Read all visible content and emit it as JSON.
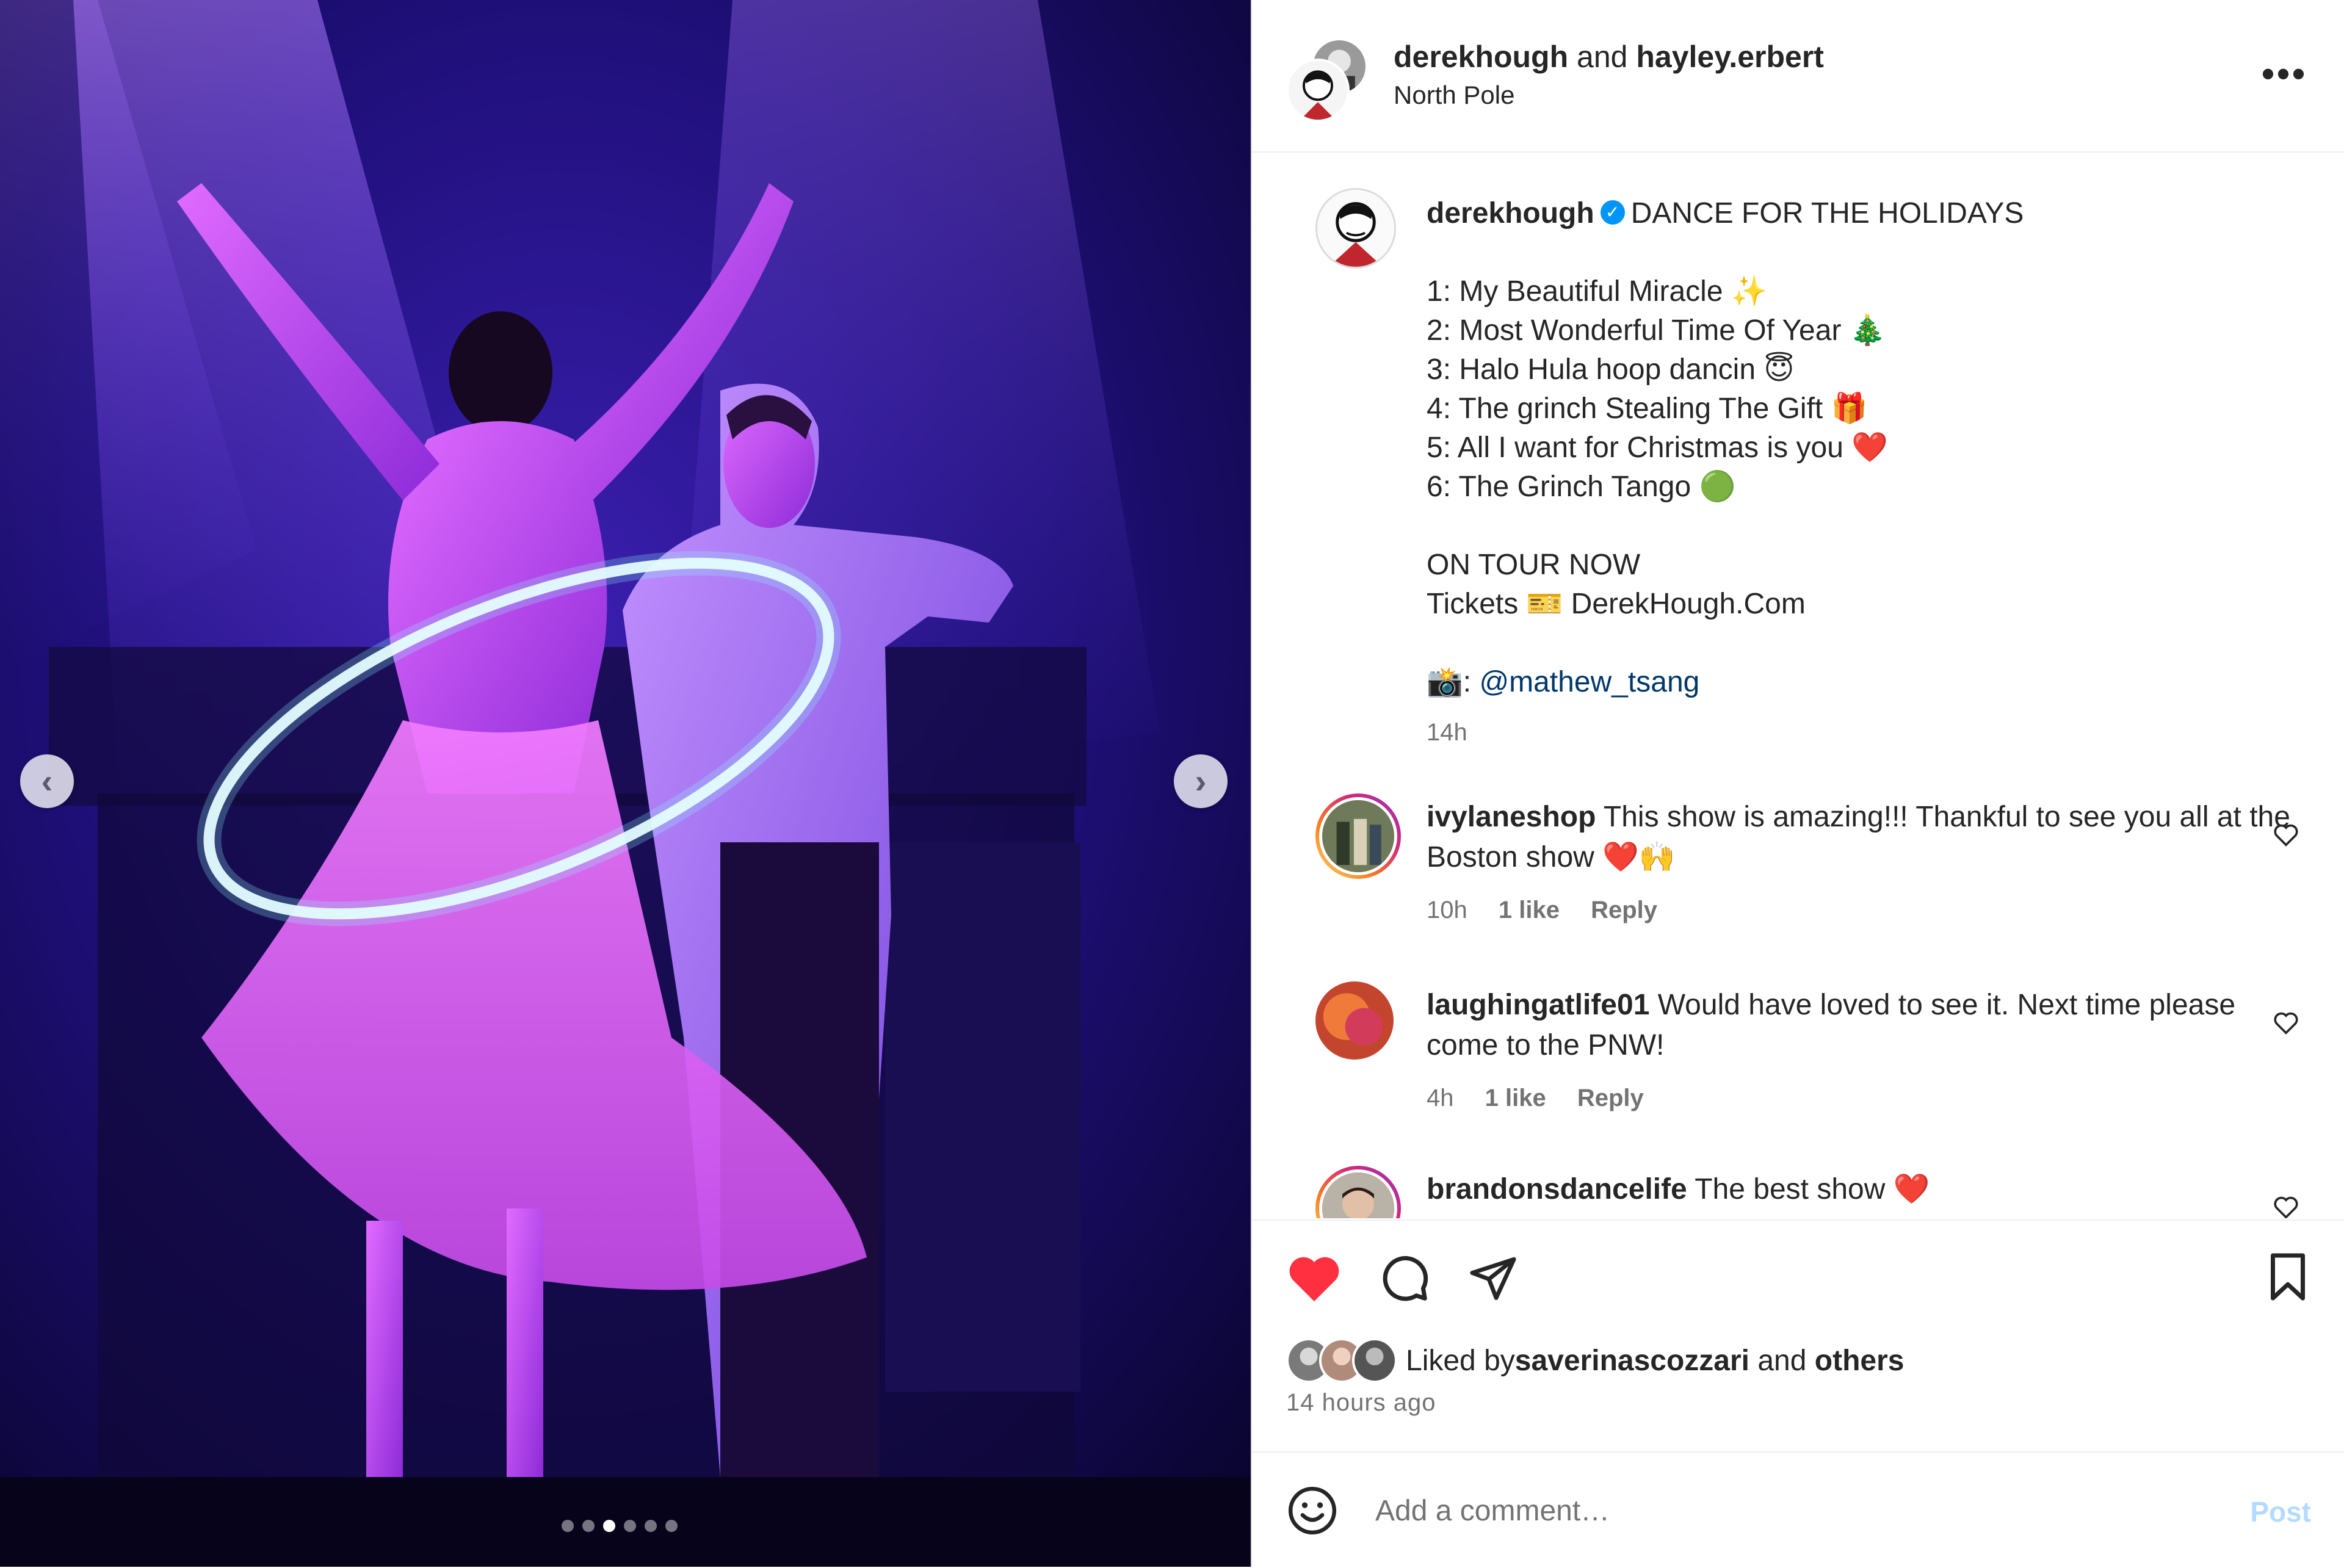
{
  "media": {
    "prev_icon": "chevron-left-icon",
    "next_icon": "chevron-right-icon",
    "prev_glyph": "‹",
    "next_glyph": "›",
    "dots_total": 6,
    "dots_active_index": 2
  },
  "header": {
    "user1": "derekhough",
    "joiner": " and ",
    "user2": "hayley.erbert",
    "location": "North Pole",
    "more": "•••"
  },
  "caption": {
    "user": "derekhough",
    "verified": "✓",
    "title": "DANCE FOR THE HOLIDAYS",
    "lines": [
      "1: My Beautiful Miracle ✨",
      "2: Most Wonderful Time Of Year 🎄",
      "3: Halo Hula hoop dancin 😇",
      "4: The grinch Stealing The Gift 🎁",
      "5: All I want for Christmas is you ❤️",
      "6: The Grinch Tango 🟢"
    ],
    "tour": "ON TOUR NOW",
    "tickets": "Tickets 🎫 DerekHough.Com",
    "photo_prefix": "📸: ",
    "photo_credit": "@mathew_tsang",
    "time": "14h"
  },
  "comments": [
    {
      "user": "ivylaneshop",
      "text": "This show is amazing!!! Thankful to see you all at the Boston show ❤️🙌",
      "time": "10h",
      "likes": "1 like",
      "reply": "Reply"
    },
    {
      "user": "laughingatlife01",
      "text": "Would have loved to see it. Next time please come to the PNW!",
      "time": "4h",
      "likes": "1 like",
      "reply": "Reply"
    },
    {
      "user": "brandonsdancelife",
      "text": "The best show ❤️",
      "time": "",
      "likes": "",
      "reply": ""
    }
  ],
  "actions": {
    "liked_prefix": "Liked by ",
    "liked_user": "saverinascozzari",
    "liked_and": " and ",
    "liked_others": "others",
    "ago": "14 hours ago"
  },
  "composer": {
    "placeholder": "Add a comment…",
    "post": "Post"
  },
  "colors": {
    "like_red": "#ff3040",
    "link_blue": "#00376b",
    "post_disabled": "#b3dbff",
    "verified_blue": "#0095f6"
  }
}
